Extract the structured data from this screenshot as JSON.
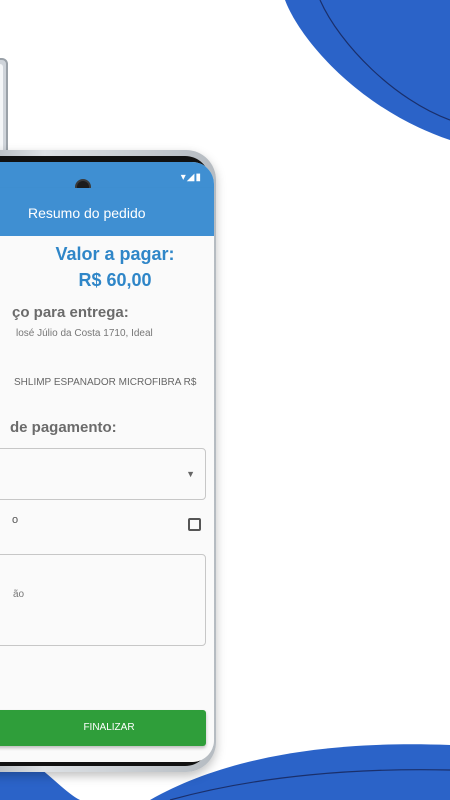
{
  "back_phone": {},
  "phone": {
    "status_bar": {
      "icons": "▾◢▮"
    },
    "app_bar": {
      "title": "Resumo do pedido"
    },
    "summary": {
      "value_label": "Valor a pagar:",
      "value_amount": "R$ 60,00"
    },
    "address": {
      "heading": "ço para entrega:",
      "text": "losé Júlio da Costa 1710, Ideal"
    },
    "product": {
      "text": "SHLIMP ESPANADOR MICROFIBRA R$"
    },
    "payment": {
      "heading": "de pagamento:",
      "selected_value": "",
      "checkbox_label": "o"
    },
    "observation": {
      "placeholder": "ão"
    },
    "finalize_button": {
      "label": "FINALIZAR"
    }
  },
  "colors": {
    "accent": "#3f8fd2",
    "value_text": "#2f86c8",
    "finalize": "#2f9e3a",
    "wave": "#2b5fc4"
  }
}
